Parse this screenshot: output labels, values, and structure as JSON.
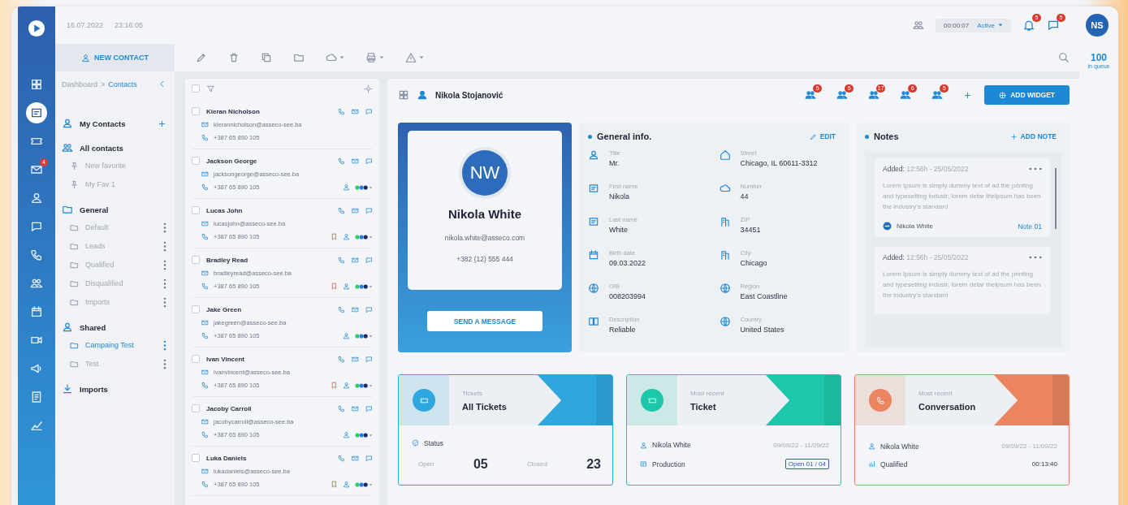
{
  "topbar": {
    "date": "16.07.2022",
    "time": "23:16:05",
    "timer": "00:00:07",
    "status": "Active",
    "notification_count": "5",
    "message_count": "5",
    "avatar": "NS"
  },
  "queue": {
    "count": "100",
    "label": "in queue"
  },
  "nav_rail": [
    {
      "selected": false
    },
    {
      "selected": true
    },
    {
      "selected": false
    },
    {
      "selected": false,
      "badge": "4"
    },
    {
      "selected": false
    },
    {
      "selected": false
    },
    {
      "selected": false
    },
    {
      "selected": false
    },
    {
      "selected": false
    },
    {
      "selected": false
    },
    {
      "selected": false
    },
    {
      "selected": false
    },
    {
      "selected": false
    }
  ],
  "toolbar": {
    "new_contact": "NEW CONTACT"
  },
  "breadcrumb": [
    "Dashboard",
    ">",
    "Contacts"
  ],
  "sidebar": [
    {
      "kind": "person",
      "label": "My Contacts",
      "addable": true
    },
    {
      "kind": "people",
      "label": "All contacts",
      "addable": false,
      "items": [
        {
          "kind": "pin",
          "label": "New favorite",
          "selected": false
        },
        {
          "kind": "pin",
          "label": "My Fav 1",
          "selected": false
        }
      ]
    },
    {
      "kind": "folder",
      "label": "General",
      "addable": false,
      "items": [
        {
          "kind": "folder",
          "label": "Default",
          "selected": false
        },
        {
          "kind": "folder",
          "label": "Leads",
          "selected": false
        },
        {
          "kind": "folder",
          "label": "Qualified",
          "selected": false
        },
        {
          "kind": "folder",
          "label": "Disqualified",
          "selected": false
        },
        {
          "kind": "folder",
          "label": "Imports",
          "selected": false
        }
      ]
    },
    {
      "kind": "person",
      "label": "Shared",
      "addable": false,
      "items": [
        {
          "kind": "folder",
          "label": "Campaing Test",
          "selected": true
        },
        {
          "kind": "folder",
          "label": "Test",
          "selected": false
        }
      ]
    },
    {
      "kind": "download",
      "label": "Imports",
      "addable": false
    }
  ],
  "list": {
    "all_selected": false
  },
  "contacts": [
    {
      "name": "Kieran Nicholson",
      "email": "kierannicholson@asseco-see.ba",
      "phone": "+387 65 890 105",
      "checked": false,
      "flagged": false,
      "tagged": false
    },
    {
      "name": "Jackson George",
      "email": "jacksongeorge@asseco-see.ba",
      "phone": "+387 65 890 105",
      "checked": false,
      "flagged": false,
      "tagged": true
    },
    {
      "name": "Lucas John",
      "email": "lucasjohn@asseco-see.ba",
      "phone": "+387 65 890 105",
      "checked": false,
      "flagged": true,
      "tagged": true
    },
    {
      "name": "Bradley Read",
      "email": "bradleyread@asseco-see.ba",
      "phone": "+387 65 890 105",
      "checked": false,
      "flagged": true,
      "tagged": true
    },
    {
      "name": "Jake Green",
      "email": "jakegreen@asseco-see.ba",
      "phone": "+387 65 890 105",
      "checked": false,
      "flagged": false,
      "tagged": true
    },
    {
      "name": "Ivan Vincent",
      "email": "ivanvincent@asseco-see.ba",
      "phone": "+387 65 890 105",
      "checked": false,
      "flagged": true,
      "tagged": true
    },
    {
      "name": "Jacoby Carroll",
      "email": "jacobycarroll@asseco-see.ba",
      "phone": "+387 65 890 105",
      "checked": false,
      "flagged": false,
      "tagged": true
    },
    {
      "name": "Luka Daniels",
      "email": "lukadaniels@asseco-see.ba",
      "phone": "+387 65 890 105",
      "checked": false,
      "flagged": true,
      "tagged": true
    }
  ],
  "main": {
    "title": "Nikola Stojanović",
    "widget_badges": [
      "5",
      "5",
      "17",
      "6",
      "5"
    ],
    "add_widget": "ADD WIDGET"
  },
  "profile": {
    "initials": "NW",
    "name": "Nikola White",
    "email": "nikola.white@asseco.com",
    "phone": "+382 (12) 555 444",
    "button": "SEND A MESSAGE"
  },
  "general_info": {
    "title": "General info.",
    "edit": "EDIT",
    "columns": [
      [
        {
          "label": "Title",
          "value": "Mr."
        },
        {
          "label": "First name",
          "value": "Nikola"
        },
        {
          "label": "Last name",
          "value": "White"
        },
        {
          "label": "Birth date",
          "value": "09.03.2022"
        },
        {
          "label": "OIB",
          "value": "008203994"
        },
        {
          "label": "Description",
          "value": "Reliable"
        }
      ],
      [
        {
          "label": "Street",
          "value": "Chicago, IL 60611-3312"
        },
        {
          "label": "Number",
          "value": "44"
        },
        {
          "label": "ZIP",
          "value": "34451"
        },
        {
          "label": "City",
          "value": "Chicago"
        },
        {
          "label": "Region",
          "value": "East Coastline"
        },
        {
          "label": "Country",
          "value": "United States"
        }
      ]
    ]
  },
  "notes": {
    "title": "Notes",
    "add": "ADD NOTE",
    "items": [
      {
        "added": "**Added:** 12:56h - 25/05/2022",
        "text": "Lorem Ipsum is simply dummy text of ad the printing and typesetting industr, lorem detar thelpsum has been the industry's standard",
        "author": "Nikola White",
        "link": "Note 01"
      },
      {
        "added": "**Added:** 12:56h - 25/05/2022",
        "text": "Lorem Ipsum is simply dummy text of ad the printing and typesetting industr, lorem detar thelpsum has been the industry's standard"
      }
    ]
  },
  "cards": [
    {
      "kind": "status",
      "color": "#2ea6de",
      "subtitle": "Tickets",
      "title": "All Tickets",
      "status_label": "Status",
      "open_label": "Open",
      "open_count": "05",
      "closed_label": "Closed",
      "closed_count": "23"
    },
    {
      "kind": "recent",
      "color": "#1fc7aa",
      "subtitle": "Most recent",
      "title": "Ticket",
      "person": "Nikola White",
      "dates": "09/09/22 - 11/09/22",
      "detail": "Production",
      "value": "Open 01 / 04",
      "boxed": true
    },
    {
      "kind": "recent",
      "color": "#ea8560",
      "subtitle": "Most recent",
      "title": "Conversation",
      "person": "Nikola White",
      "dates": "09/09/22 - 11/09/22",
      "detail": "Qualified",
      "value": "00:13:40",
      "boxed": false
    }
  ]
}
